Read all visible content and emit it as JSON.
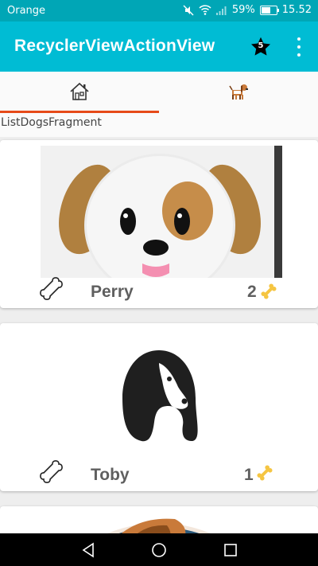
{
  "status_bar": {
    "carrier": "Orange",
    "battery": "59%",
    "time": "15.52"
  },
  "app_bar": {
    "title": "RecyclerViewActionView",
    "badge_count": "5",
    "accent": "#00bcd4",
    "status_color": "#00a6b6"
  },
  "tabs": [
    {
      "icon": "house-icon",
      "selected": true
    },
    {
      "icon": "dog-icon",
      "selected": false
    }
  ],
  "fragment_label": "ListDogsFragment",
  "dogs": [
    {
      "name": "Perry",
      "bones": "2"
    },
    {
      "name": "Toby",
      "bones": "1"
    }
  ],
  "nav": [
    "back-icon",
    "home-icon",
    "recents-icon"
  ]
}
